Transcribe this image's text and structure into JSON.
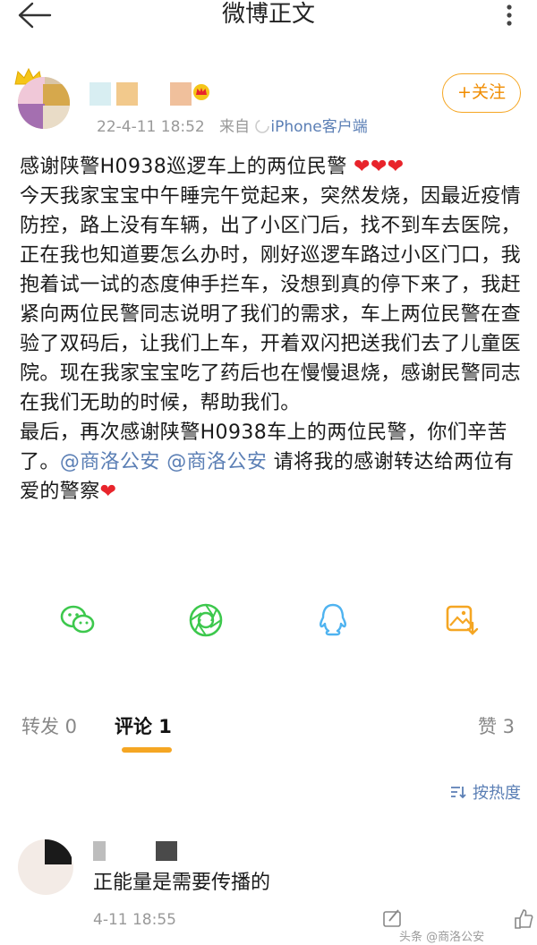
{
  "header": {
    "title": "微博正文",
    "back_icon": "back-arrow-icon",
    "more_icon": "more-vertical-icon"
  },
  "author": {
    "date": "22-4-11 18:52",
    "source_prefix": "来自",
    "source": "iPhone客户端",
    "follow_label": "+关注"
  },
  "post": {
    "lines": [
      "感谢陕警H0938巡逻车上的两位民警",
      "今天我家宝宝中午睡完午觉起来，突然发烧，因最近疫情防控，路上没有车辆，出了小区门后，找不到车去医院，正在我也知道要怎么办时，刚好巡逻车路过小区门口，我抱着试一试的态度伸手拦车，没想到真的停下来了，我赶紧向两位民警同志说明了我们的需求，车上两位民警在查验了双码后，让我们上车，开着双闪把送我们去了儿童医院。现在我家宝宝吃了药后也在慢慢退烧，感谢民警同志在我们无助的时候，帮助我们。"
    ],
    "hearts": "❤❤❤",
    "closing_prefix": "最后，再次感谢陕警H0938车上的两位民警，你们辛苦了。",
    "mention_1": "@商洛公安",
    "mention_2": "@商洛公安",
    "closing_suffix": "请将我的感谢转达给两位有爱的警察",
    "closing_heart": "❤"
  },
  "share_icons": [
    "wechat-icon",
    "moments-icon",
    "qq-icon",
    "save-image-icon"
  ],
  "colors": {
    "accent": "#f5a623",
    "link": "#5b7fb5",
    "heart": "#e8242b",
    "green": "#3dc84d",
    "qq": "#4fb3f0"
  },
  "tabs": {
    "repost": "转发 0",
    "comment": "评论 1",
    "like": "赞 3"
  },
  "sort_label": "按热度",
  "comment": {
    "text": "正能量是需要传播的",
    "time": "4-11 18:55"
  },
  "watermark": "头条 @商洛公安"
}
